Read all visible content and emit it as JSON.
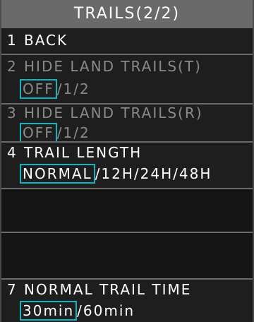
{
  "title": "TRAILS(2/2)",
  "items": [
    {
      "num": "1",
      "label": "BACK",
      "disabled": false
    },
    {
      "num": "2",
      "label": "HIDE LAND TRAILS(T)",
      "disabled": true,
      "selected": "OFF",
      "others": "/1/2"
    },
    {
      "num": "3",
      "label": "HIDE LAND TRAILS(R)",
      "disabled": true,
      "selected": "OFF",
      "others": "/1/2"
    },
    {
      "num": "4",
      "label": "TRAIL LENGTH",
      "disabled": false,
      "selected": "NORMAL",
      "others": "/12H/24H/48H"
    },
    {
      "num": "7",
      "label": "NORMAL TRAIL TIME",
      "disabled": false,
      "selected": "30min",
      "others": "/60min"
    }
  ],
  "colors": {
    "selection_border": "#19b0c0",
    "title_bar": "#6a6a6a",
    "disabled_text": "#8a8a8a",
    "text": "#ffffff"
  }
}
